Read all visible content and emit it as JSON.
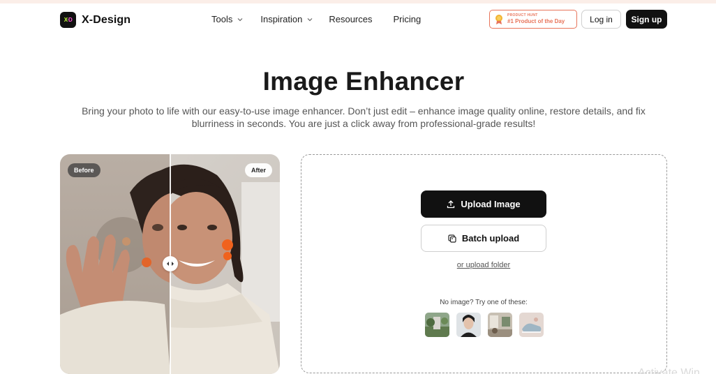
{
  "header": {
    "brand": "X-Design",
    "nav": {
      "tools": "Tools",
      "inspiration": "Inspiration",
      "resources": "Resources",
      "pricing": "Pricing"
    },
    "badge": {
      "top": "PRODUCT HUNT",
      "main": "#1 Product of the Day"
    },
    "login": "Log in",
    "signup": "Sign up"
  },
  "hero": {
    "title": "Image Enhancer",
    "subtitle_line1": "Bring your photo to life with our easy-to-use image enhancer. Don’t just edit – enhance image quality online, restore details, and fix",
    "subtitle_line2": "blurriness in seconds. You are just a click away from professional-grade results!"
  },
  "compare": {
    "before_label": "Before",
    "after_label": "After"
  },
  "upload": {
    "upload_label": "Upload Image",
    "batch_label": "Batch upload",
    "folder_link": "or upload folder",
    "no_image_text": "No image? Try one of these:"
  },
  "watermark": "Activate Win",
  "colors": {
    "accent_orange": "#e8745a",
    "primary_dark": "#111111"
  }
}
